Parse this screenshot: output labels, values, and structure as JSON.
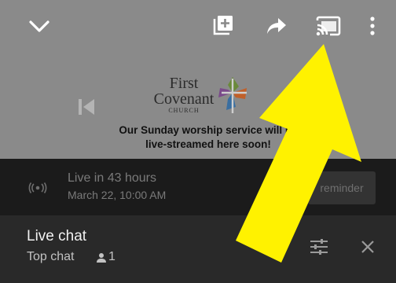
{
  "video": {
    "logo": {
      "line1": "First",
      "line2": "Covenant",
      "line3": "CHURCH"
    },
    "promo_line1": "Our Sunday worship service will be",
    "promo_line2": "live-streamed here soon!"
  },
  "live": {
    "title": "Live in 43 hours",
    "date": "March 22, 10:00 AM",
    "reminder_label": "reminder"
  },
  "chat": {
    "title": "Live chat",
    "mode": "Top chat",
    "viewers": "1"
  },
  "icons": {
    "collapse": "chevron-down-icon",
    "add": "add-to-playlist-icon",
    "share": "share-icon",
    "cast": "cast-icon",
    "more": "more-vert-icon",
    "previous": "skip-previous-icon",
    "live": "live-broadcast-icon",
    "person": "person-icon",
    "filter": "tune-icon",
    "close": "close-icon"
  },
  "colors": {
    "video_bg": "#8a8a8a",
    "live_bar_bg": "#1b1b1b",
    "chat_header_bg": "#292929",
    "arrow": "#fff200"
  }
}
